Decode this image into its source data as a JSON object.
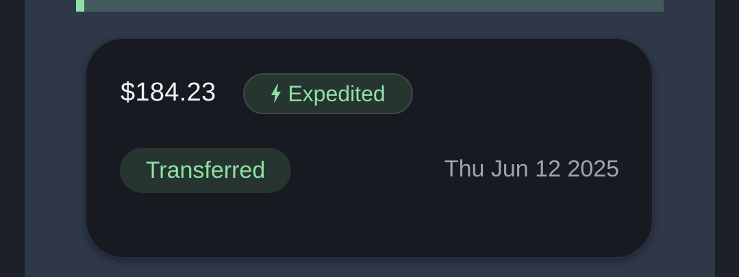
{
  "transfer": {
    "progress_fraction": 0.014,
    "amount": "$184.23",
    "speed": {
      "icon": "bolt-icon",
      "label": "Expedited"
    },
    "status": "Transferred",
    "date": "Thu Jun 12 2025"
  },
  "colors": {
    "accent_green": "#8fe0a6",
    "card_background": "#181a21",
    "panel_background": "#2f3849",
    "badge_background": "#26352f",
    "date_text": "#9ba5b6"
  }
}
